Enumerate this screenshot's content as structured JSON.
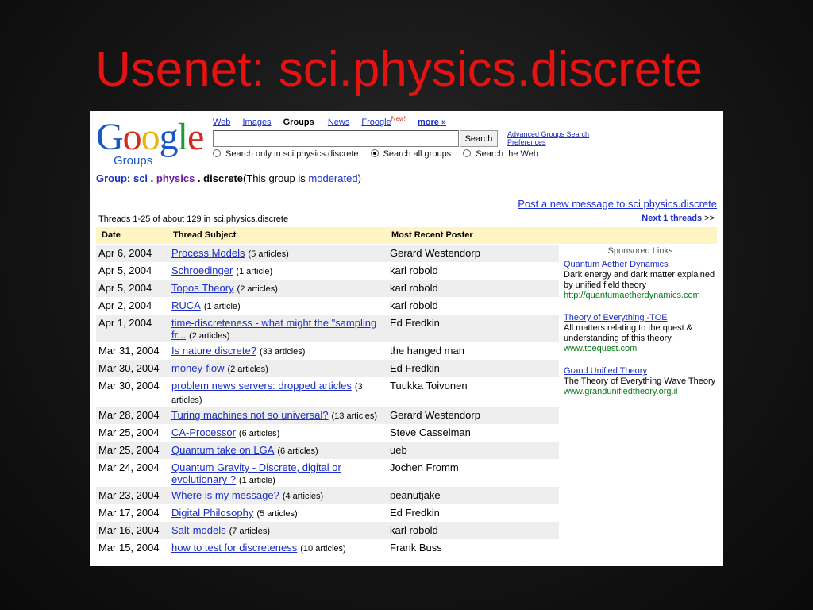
{
  "slide": {
    "title": "Usenet: sci.physics.discrete"
  },
  "logo": {
    "letters": [
      "G",
      "o",
      "o",
      "g",
      "l",
      "e"
    ],
    "sub": "Groups"
  },
  "nav": {
    "web": "Web",
    "images": "Images",
    "groups": "Groups",
    "news": "News",
    "froogle": "Froogle",
    "new_badge": "New!",
    "more": "more »"
  },
  "search": {
    "value": "",
    "button": "Search",
    "advanced": "Advanced Groups Search",
    "preferences": "Preferences",
    "option1": "Search only in sci.physics.discrete",
    "option2": "Search all groups",
    "option3": "Search the Web"
  },
  "breadcrumb": {
    "group_label": "Group",
    "sep1": ":",
    "part1": "sci",
    "dot1": " . ",
    "part2": "physics",
    "dot2": " . ",
    "part3": "discrete",
    "moderated_pre": "(This group is ",
    "moderated_link": "moderated",
    "moderated_post": ")"
  },
  "post_link": "Post a new message to sci.physics.discrete",
  "threads_info": "Threads 1-25 of about 129 in sci.physics.discrete",
  "next": {
    "label": "Next 1 threads",
    "arrow": " >>"
  },
  "table": {
    "headers": {
      "date": "Date",
      "subject": "Thread Subject",
      "poster": "Most Recent Poster"
    },
    "rows": [
      {
        "date": "Apr 6, 2004",
        "subject": "Process Models",
        "count": "(5 articles)",
        "poster": "Gerard Westendorp"
      },
      {
        "date": "Apr 5, 2004",
        "subject": "Schroedinger",
        "count": "(1 article)",
        "poster": "karl robold"
      },
      {
        "date": "Apr 5, 2004",
        "subject": "Topos Theory",
        "count": "(2 articles)",
        "poster": "karl robold"
      },
      {
        "date": "Apr 2, 2004",
        "subject": "RUCA",
        "count": "(1 article)",
        "poster": "karl robold"
      },
      {
        "date": "Apr 1, 2004",
        "subject": "time-discreteness - what might the \"sampling fr...",
        "count": "(2 articles)",
        "poster": "Ed Fredkin"
      },
      {
        "date": "Mar 31, 2004",
        "subject": "Is nature discrete?",
        "count": "(33 articles)",
        "poster": "the hanged man"
      },
      {
        "date": "Mar 30, 2004",
        "subject": "money-flow",
        "count": "(2 articles)",
        "poster": "Ed Fredkin"
      },
      {
        "date": "Mar 30, 2004",
        "subject": "problem news servers: dropped articles",
        "count": "(3 articles)",
        "poster": "Tuukka Toivonen"
      },
      {
        "date": "Mar 28, 2004",
        "subject": "Turing machines not so universal?",
        "count": "(13 articles)",
        "poster": "Gerard Westendorp"
      },
      {
        "date": "Mar 25, 2004",
        "subject": "CA-Processor",
        "count": "(6 articles)",
        "poster": "Steve Casselman"
      },
      {
        "date": "Mar 25, 2004",
        "subject": "Quantum take on LGA",
        "count": "(6 articles)",
        "poster": "ueb"
      },
      {
        "date": "Mar 24, 2004",
        "subject": "Quantum Gravity - Discrete, digital or evolutionary ?",
        "count": "(1 article)",
        "poster": "Jochen Fromm"
      },
      {
        "date": "Mar 23, 2004",
        "subject": "Where is my message?",
        "count": "(4 articles)",
        "poster": "peanutjake"
      },
      {
        "date": "Mar 17, 2004",
        "subject": "Digital Philosophy",
        "count": "(5 articles)",
        "poster": "Ed Fredkin"
      },
      {
        "date": "Mar 16, 2004",
        "subject": "Salt-models",
        "count": "(7 articles)",
        "poster": "karl robold"
      },
      {
        "date": "Mar 15, 2004",
        "subject": "how to test for discreteness",
        "count": "(10 articles)",
        "poster": "Frank Buss"
      }
    ]
  },
  "ads": {
    "header": "Sponsored Links",
    "items": [
      {
        "title": "Quantum Aether Dynamics",
        "text": "Dark energy and dark matter explained by unified field theory",
        "url": "http://quantumaetherdynamics.com"
      },
      {
        "title": "Theory of Everything -TOE",
        "text": "All matters relating to the quest & understanding of this theory.",
        "url": "www.toequest.com"
      },
      {
        "title": "Grand Unified Theory",
        "text": "The Theory of Everything Wave Theory",
        "url": "www.grandunifiedtheory.org.il"
      }
    ]
  }
}
